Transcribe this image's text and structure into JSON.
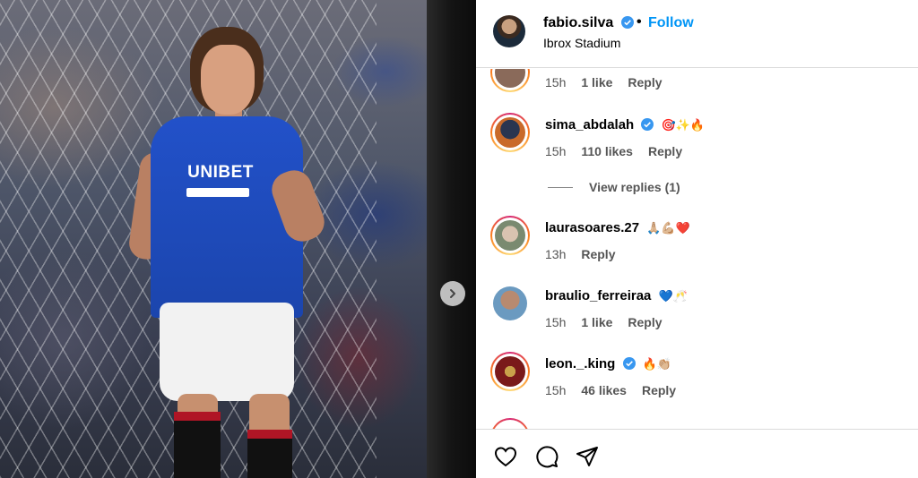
{
  "header": {
    "username": "fabio.silva",
    "separator": "•",
    "follow_label": "Follow",
    "location": "Ibrox Stadium"
  },
  "photo": {
    "shirt_sponsor": "UNIBET",
    "next_icon": "chevron-right-icon"
  },
  "comments": [
    {
      "username": "",
      "emoji": "",
      "time": "15h",
      "likes": "1 like",
      "reply": "Reply",
      "partial": true
    },
    {
      "username": "sima_abdalah",
      "verified": true,
      "emoji": "🎯✨🔥",
      "time": "15h",
      "likes": "110 likes",
      "reply": "Reply"
    },
    {
      "username": "laurasoares.27",
      "verified": false,
      "emoji": "🙏🏼💪🏼❤️",
      "time": "13h",
      "likes": "",
      "reply": "Reply"
    },
    {
      "username": "braulio_ferreiraa",
      "verified": false,
      "emoji": "💙🥂",
      "time": "15h",
      "likes": "1 like",
      "reply": "Reply"
    },
    {
      "username": "leon._.king",
      "verified": true,
      "emoji": "🔥👏🏼",
      "time": "15h",
      "likes": "46 likes",
      "reply": "Reply"
    }
  ],
  "view_replies": "View replies (1)",
  "footer": {
    "icons": [
      "heart-icon",
      "comment-icon",
      "share-icon"
    ]
  },
  "colors": {
    "follow": "#0095f6",
    "verified": "#3897f0",
    "shirt": "#2251c9"
  }
}
